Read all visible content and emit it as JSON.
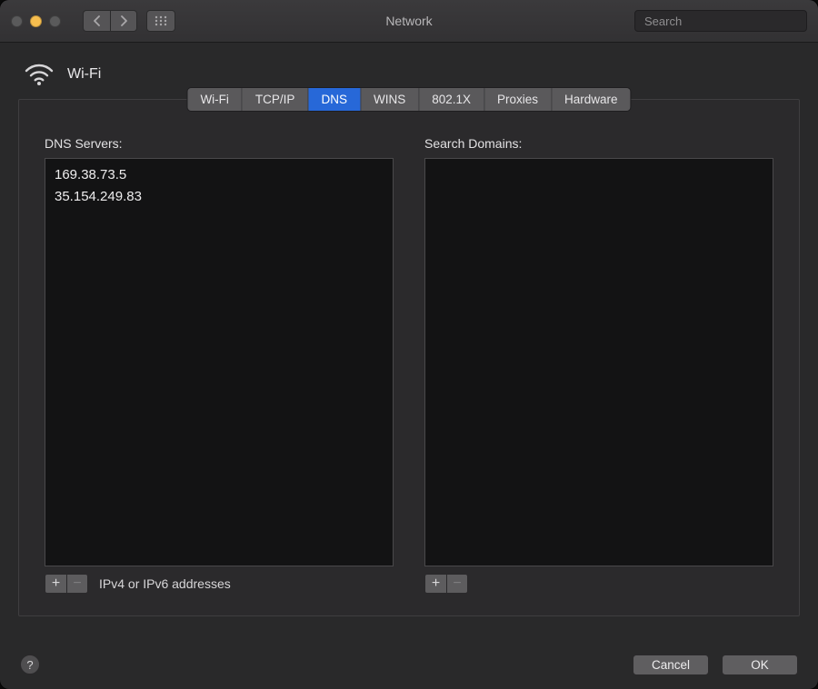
{
  "window": {
    "title": "Network"
  },
  "search": {
    "placeholder": "Search",
    "value": ""
  },
  "interface": {
    "name": "Wi-Fi"
  },
  "tabs": [
    {
      "label": "Wi-Fi",
      "active": false
    },
    {
      "label": "TCP/IP",
      "active": false
    },
    {
      "label": "DNS",
      "active": true
    },
    {
      "label": "WINS",
      "active": false
    },
    {
      "label": "802.1X",
      "active": false
    },
    {
      "label": "Proxies",
      "active": false
    },
    {
      "label": "Hardware",
      "active": false
    }
  ],
  "dns": {
    "label": "DNS Servers:",
    "servers": [
      "169.38.73.5",
      "35.154.249.83"
    ],
    "hint": "IPv4 or IPv6 addresses"
  },
  "search_domains": {
    "label": "Search Domains:",
    "domains": []
  },
  "buttons": {
    "cancel": "Cancel",
    "ok": "OK",
    "add": "+",
    "remove": "−",
    "help": "?"
  }
}
